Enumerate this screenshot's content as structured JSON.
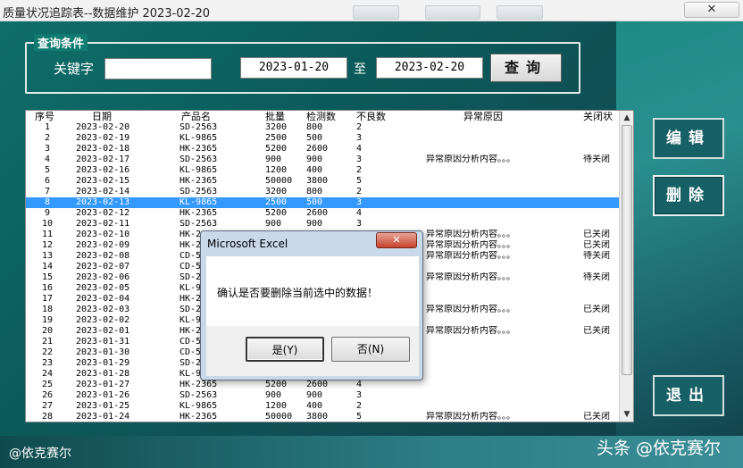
{
  "window": {
    "title": "质量状况追踪表--数据维护 2023-02-20",
    "close_glyph": "✕"
  },
  "query": {
    "group_label": "查询条件",
    "keyword_label": "关键字",
    "keyword_value": "",
    "date_from": "2023-01-20",
    "to_label": "至",
    "date_to": "2023-02-20",
    "search_label": "查询"
  },
  "actions": {
    "edit": "编辑",
    "delete": "删除",
    "exit": "退出"
  },
  "table": {
    "columns": [
      "序号",
      "日期",
      "产品名",
      "批量",
      "检测数",
      "不良数",
      "异常原因",
      "关闭状"
    ],
    "selected_index": 7,
    "rows": [
      [
        "1",
        "2023-02-20",
        "SD-2563",
        "3200",
        "800",
        "2",
        "",
        ""
      ],
      [
        "2",
        "2023-02-19",
        "KL-9865",
        "2500",
        "500",
        "3",
        "",
        ""
      ],
      [
        "3",
        "2023-02-18",
        "HK-2365",
        "5200",
        "2600",
        "4",
        "",
        ""
      ],
      [
        "4",
        "2023-02-17",
        "SD-2563",
        "900",
        "900",
        "3",
        "异常原因分析内容。。。",
        "待关闭"
      ],
      [
        "5",
        "2023-02-16",
        "KL-9865",
        "1200",
        "400",
        "2",
        "",
        ""
      ],
      [
        "6",
        "2023-02-15",
        "HK-2365",
        "50000",
        "3800",
        "5",
        "",
        ""
      ],
      [
        "7",
        "2023-02-14",
        "SD-2563",
        "3200",
        "800",
        "2",
        "",
        ""
      ],
      [
        "8",
        "2023-02-13",
        "KL-9865",
        "2500",
        "500",
        "3",
        "",
        ""
      ],
      [
        "9",
        "2023-02-12",
        "HK-2365",
        "5200",
        "2600",
        "4",
        "",
        ""
      ],
      [
        "10",
        "2023-02-11",
        "SD-2563",
        "900",
        "900",
        "3",
        "",
        ""
      ],
      [
        "11",
        "2023-02-10",
        "HK-2",
        "",
        "",
        "",
        "异常原因分析内容。。。",
        "已关闭"
      ],
      [
        "12",
        "2023-02-09",
        "HK-2",
        "",
        "",
        "",
        "异常原因分析内容。。。",
        "已关闭"
      ],
      [
        "13",
        "2023-02-08",
        "CD-5",
        "",
        "",
        "",
        "异常原因分析内容。。。",
        "待关闭"
      ],
      [
        "14",
        "2023-02-07",
        "CD-5",
        "",
        "",
        "",
        "",
        ""
      ],
      [
        "15",
        "2023-02-06",
        "SD-2",
        "",
        "",
        "",
        "异常原因分析内容。。。",
        "待关闭"
      ],
      [
        "16",
        "2023-02-05",
        "KL-9",
        "",
        "",
        "",
        "",
        ""
      ],
      [
        "17",
        "2023-02-04",
        "HK-2",
        "",
        "",
        "",
        "",
        ""
      ],
      [
        "18",
        "2023-02-03",
        "SD-2",
        "",
        "",
        "",
        "异常原因分析内容。。。",
        "已关闭"
      ],
      [
        "19",
        "2023-02-02",
        "KL-9",
        "",
        "",
        "",
        "",
        ""
      ],
      [
        "20",
        "2023-02-01",
        "HK-2",
        "",
        "",
        "",
        "异常原因分析内容。。。",
        "已关闭"
      ],
      [
        "21",
        "2023-01-31",
        "CD-5",
        "",
        "",
        "",
        "",
        ""
      ],
      [
        "22",
        "2023-01-30",
        "CD-5",
        "",
        "",
        "",
        "",
        ""
      ],
      [
        "23",
        "2023-01-29",
        "SD-2",
        "",
        "",
        "",
        "",
        ""
      ],
      [
        "24",
        "2023-01-28",
        "KL-9",
        "",
        "",
        "",
        "",
        ""
      ],
      [
        "25",
        "2023-01-27",
        "HK-2365",
        "5200",
        "2600",
        "4",
        "",
        ""
      ],
      [
        "26",
        "2023-01-26",
        "SD-2563",
        "900",
        "900",
        "3",
        "",
        ""
      ],
      [
        "27",
        "2023-01-25",
        "KL-9865",
        "1200",
        "400",
        "2",
        "",
        ""
      ],
      [
        "28",
        "2023-01-24",
        "HK-2365",
        "50000",
        "3800",
        "5",
        "异常原因分析内容。。。",
        "已关闭"
      ]
    ]
  },
  "dialog": {
    "title": "Microsoft Excel",
    "close_glyph": "✕",
    "message": "确认是否要删除当前选中的数据！",
    "yes_label": "是(Y)",
    "no_label": "否(N)"
  },
  "footer": {
    "watermark": "@依克赛尔",
    "brand": "头条 @依克赛尔"
  }
}
